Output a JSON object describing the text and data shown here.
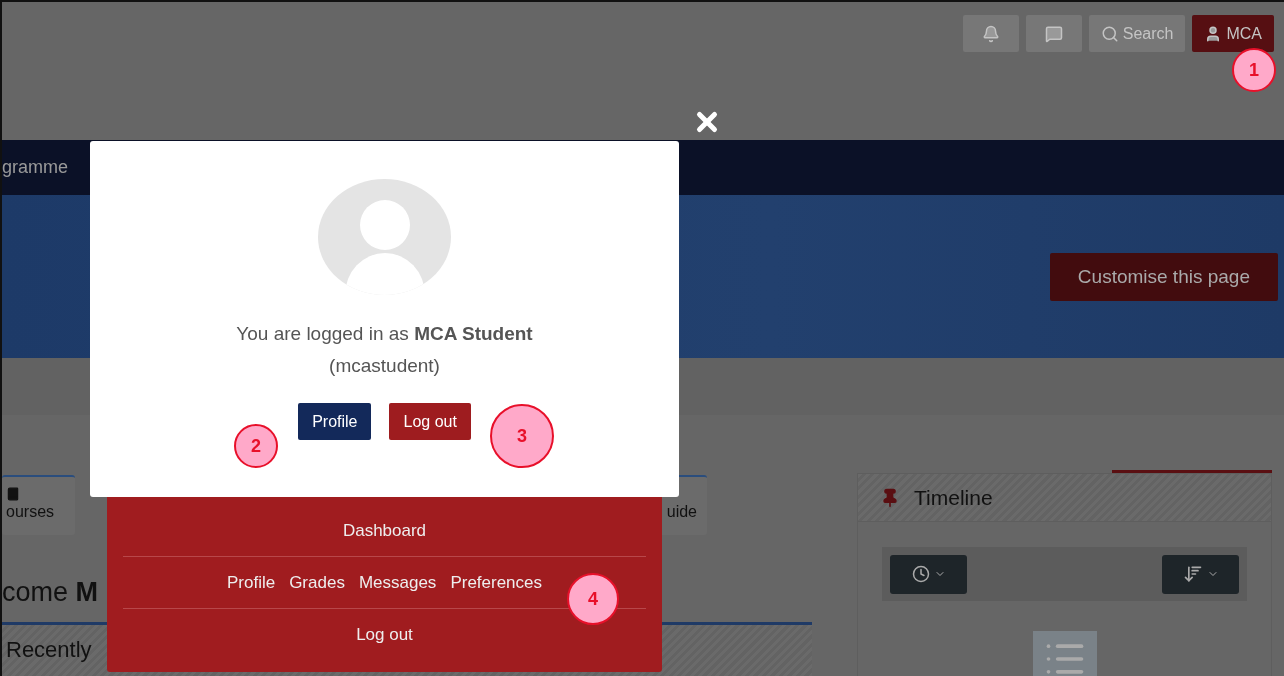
{
  "navbar": {
    "buttons": [
      {
        "kind": "bell"
      },
      {
        "kind": "chat"
      },
      {
        "kind": "search",
        "label": "Search"
      },
      {
        "kind": "user",
        "label": "MCA"
      }
    ]
  },
  "main_nav": {
    "text": "gramme"
  },
  "hero": {
    "button": "Customise this page"
  },
  "tabs": [
    {
      "label": "ourses",
      "kind": "book"
    },
    {
      "label": "uide"
    }
  ],
  "heading": "come **M**",
  "recent_card": {
    "title": "Recently"
  },
  "timeline": {
    "title": "Timeline"
  },
  "modal": {
    "message": "You are logged in as **MCA Student**",
    "username": "(mcastudent)",
    "buttons": [
      {
        "label": "Profile",
        "kind": "primary"
      },
      {
        "label": "Log out",
        "kind": "danger"
      }
    ]
  },
  "dropdown": {
    "rows": [
      [
        "Dashboard"
      ],
      [
        "Profile",
        "Grades",
        "Messages",
        "Preferences"
      ],
      [
        "Log out"
      ]
    ]
  },
  "annotations": [
    "1",
    "2",
    "3",
    "4"
  ]
}
